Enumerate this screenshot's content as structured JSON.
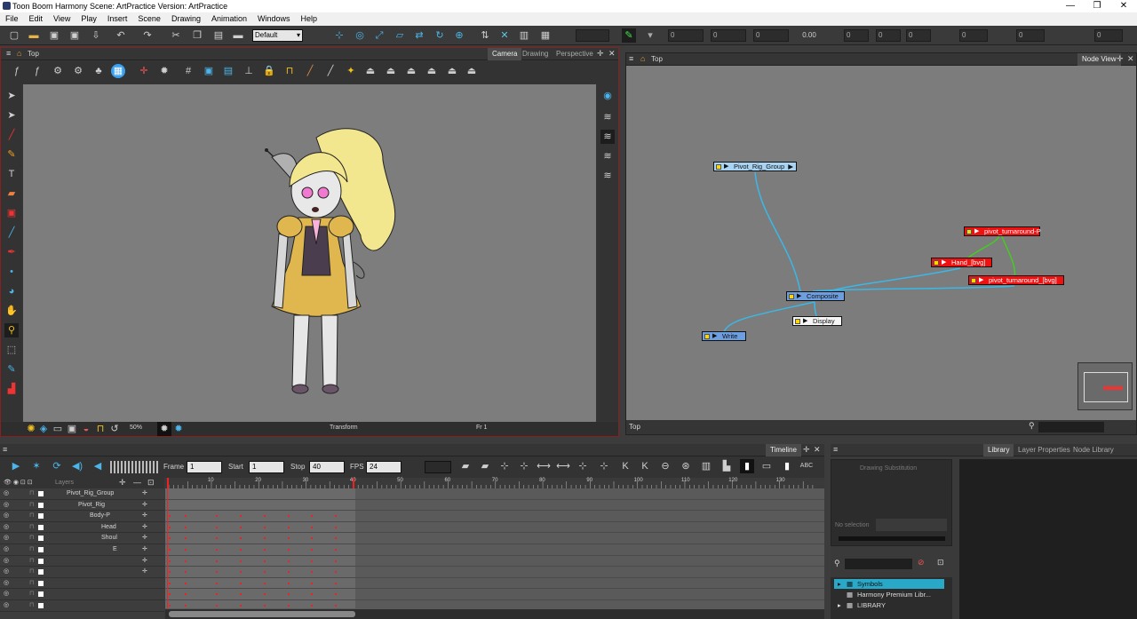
{
  "window": {
    "title": "Toon Boom Harmony Scene: ArtPractice Version: ArtPractice",
    "controls": [
      "—",
      "❐",
      "✕"
    ]
  },
  "menu": [
    "File",
    "Edit",
    "View",
    "Play",
    "Insert",
    "Scene",
    "Drawing",
    "Animation",
    "Windows",
    "Help"
  ],
  "toolbar": {
    "workspace": "Default",
    "zoom_field": "0.00",
    "fields": [
      "0",
      "0",
      "0",
      "0",
      "0",
      "0",
      "0",
      "0",
      "0",
      "0"
    ]
  },
  "camera_panel": {
    "breadcrumb": "Top",
    "tabs": [
      "Camera",
      "Drawing",
      "Perspective"
    ],
    "active_tab": "Camera",
    "zoom": "50%",
    "tool_name": "Transform",
    "frame": "Fr 1"
  },
  "node_view": {
    "breadcrumb": "Top",
    "tab": "Node View",
    "status": "Top",
    "nodes": [
      {
        "label": "Pivot_Rig_Group",
        "type": "group",
        "color": "#a9d3f2"
      },
      {
        "label": "pivot_turnaround-P",
        "type": "peg",
        "color": "#ee1111"
      },
      {
        "label": "Hand_[bvg]",
        "type": "drawing",
        "color": "#ee1111"
      },
      {
        "label": "pivot_turnaround_[bvg]",
        "type": "drawing",
        "color": "#ee1111"
      },
      {
        "label": "Composite",
        "type": "composite",
        "color": "#6d9ee0"
      },
      {
        "label": "Display",
        "type": "display",
        "color": "#f5f5f5"
      },
      {
        "label": "Write",
        "type": "write",
        "color": "#6d9ee0"
      }
    ]
  },
  "timeline": {
    "tab": "Timeline",
    "frame_label": "Frame",
    "frame_value": "1",
    "start_label": "Start",
    "start_value": "1",
    "stop_label": "Stop",
    "stop_value": "40",
    "fps_label": "FPS",
    "fps_value": "24",
    "layers_header": "Layers",
    "ruler_ticks": [
      "10",
      "20",
      "30",
      "40",
      "50",
      "60",
      "70",
      "80",
      "90",
      "100",
      "110",
      "120",
      "130"
    ],
    "layers": [
      {
        "name": "Pivot_Rig_Group",
        "indent": 0
      },
      {
        "name": "Pivot_Rig",
        "indent": 1
      },
      {
        "name": "Body-P",
        "indent": 2
      },
      {
        "name": "Head",
        "indent": 3
      },
      {
        "name": "Shoul",
        "indent": 3
      },
      {
        "name": "E",
        "indent": 4
      },
      {
        "name": "",
        "indent": 5
      },
      {
        "name": "",
        "indent": 5
      },
      {
        "name": "",
        "indent": 0
      },
      {
        "name": "",
        "indent": 0
      },
      {
        "name": "",
        "indent": 0
      }
    ]
  },
  "library": {
    "tabs": [
      "Library",
      "Layer Properties",
      "Node Library"
    ],
    "active_tab": "Library",
    "drawing_substitution": "Drawing Substitution",
    "no_selection": "No selection",
    "tree": [
      {
        "label": "Symbols",
        "selected": true
      },
      {
        "label": "Harmony Premium Libr...",
        "selected": false
      },
      {
        "label": "LIBRARY",
        "selected": false
      }
    ]
  }
}
